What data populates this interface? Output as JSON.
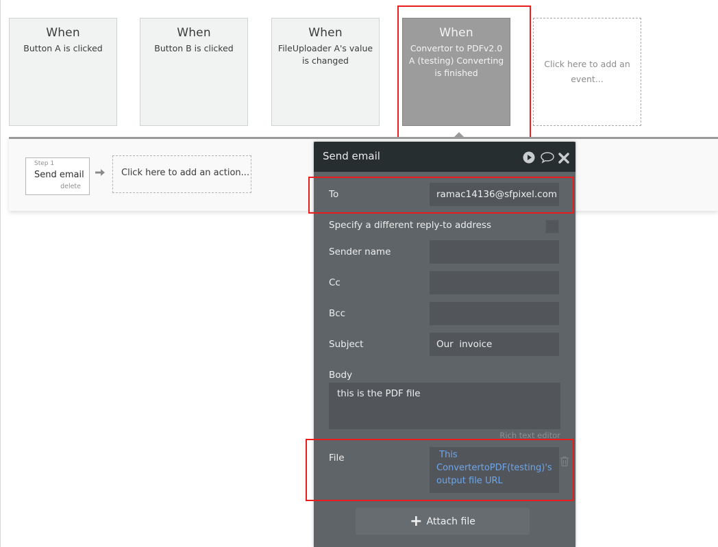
{
  "events": [
    {
      "when": "When",
      "description": "Button A is clicked",
      "selected": false
    },
    {
      "when": "When",
      "description": "Button B is clicked",
      "selected": false
    },
    {
      "when": "When",
      "description": "FileUploader A's value is changed",
      "selected": false
    },
    {
      "when": "When",
      "description": "Convertor to PDFv2.0 A (testing) Converting is finished",
      "selected": true
    }
  ],
  "add_event_label": "Click here to add an event...",
  "workflow": {
    "step": {
      "number_label": "Step 1",
      "name": "Send email",
      "delete_label": "delete"
    },
    "add_action_label": "Click here to add an action..."
  },
  "panel": {
    "title": "Send email",
    "icons": [
      "play-icon",
      "comment-icon",
      "close-icon"
    ],
    "fields": {
      "to": {
        "label": "To",
        "value": "ramac14136@sfpixel.com"
      },
      "reply_to": {
        "label": "Specify a different reply-to address",
        "checked": false
      },
      "sender_name": {
        "label": "Sender name",
        "value": ""
      },
      "cc": {
        "label": "Cc",
        "value": ""
      },
      "bcc": {
        "label": "Bcc",
        "value": ""
      },
      "subject": {
        "label": "Subject",
        "value": "Our  invoice"
      },
      "body": {
        "label": "Body",
        "value": "this is the PDF file"
      },
      "rich_text_label": "Rich text editor",
      "file": {
        "label": "File",
        "value": " This ConvertertoPDF(testing)'s output file URL"
      }
    },
    "attach_button_label": "Attach file"
  },
  "colors": {
    "highlight": "#ea1c1c",
    "panel_bg": "#5f6468",
    "panel_header": "#272e30",
    "link_blue": "#6ea6eb",
    "selected_event": "#9c9c9c"
  }
}
